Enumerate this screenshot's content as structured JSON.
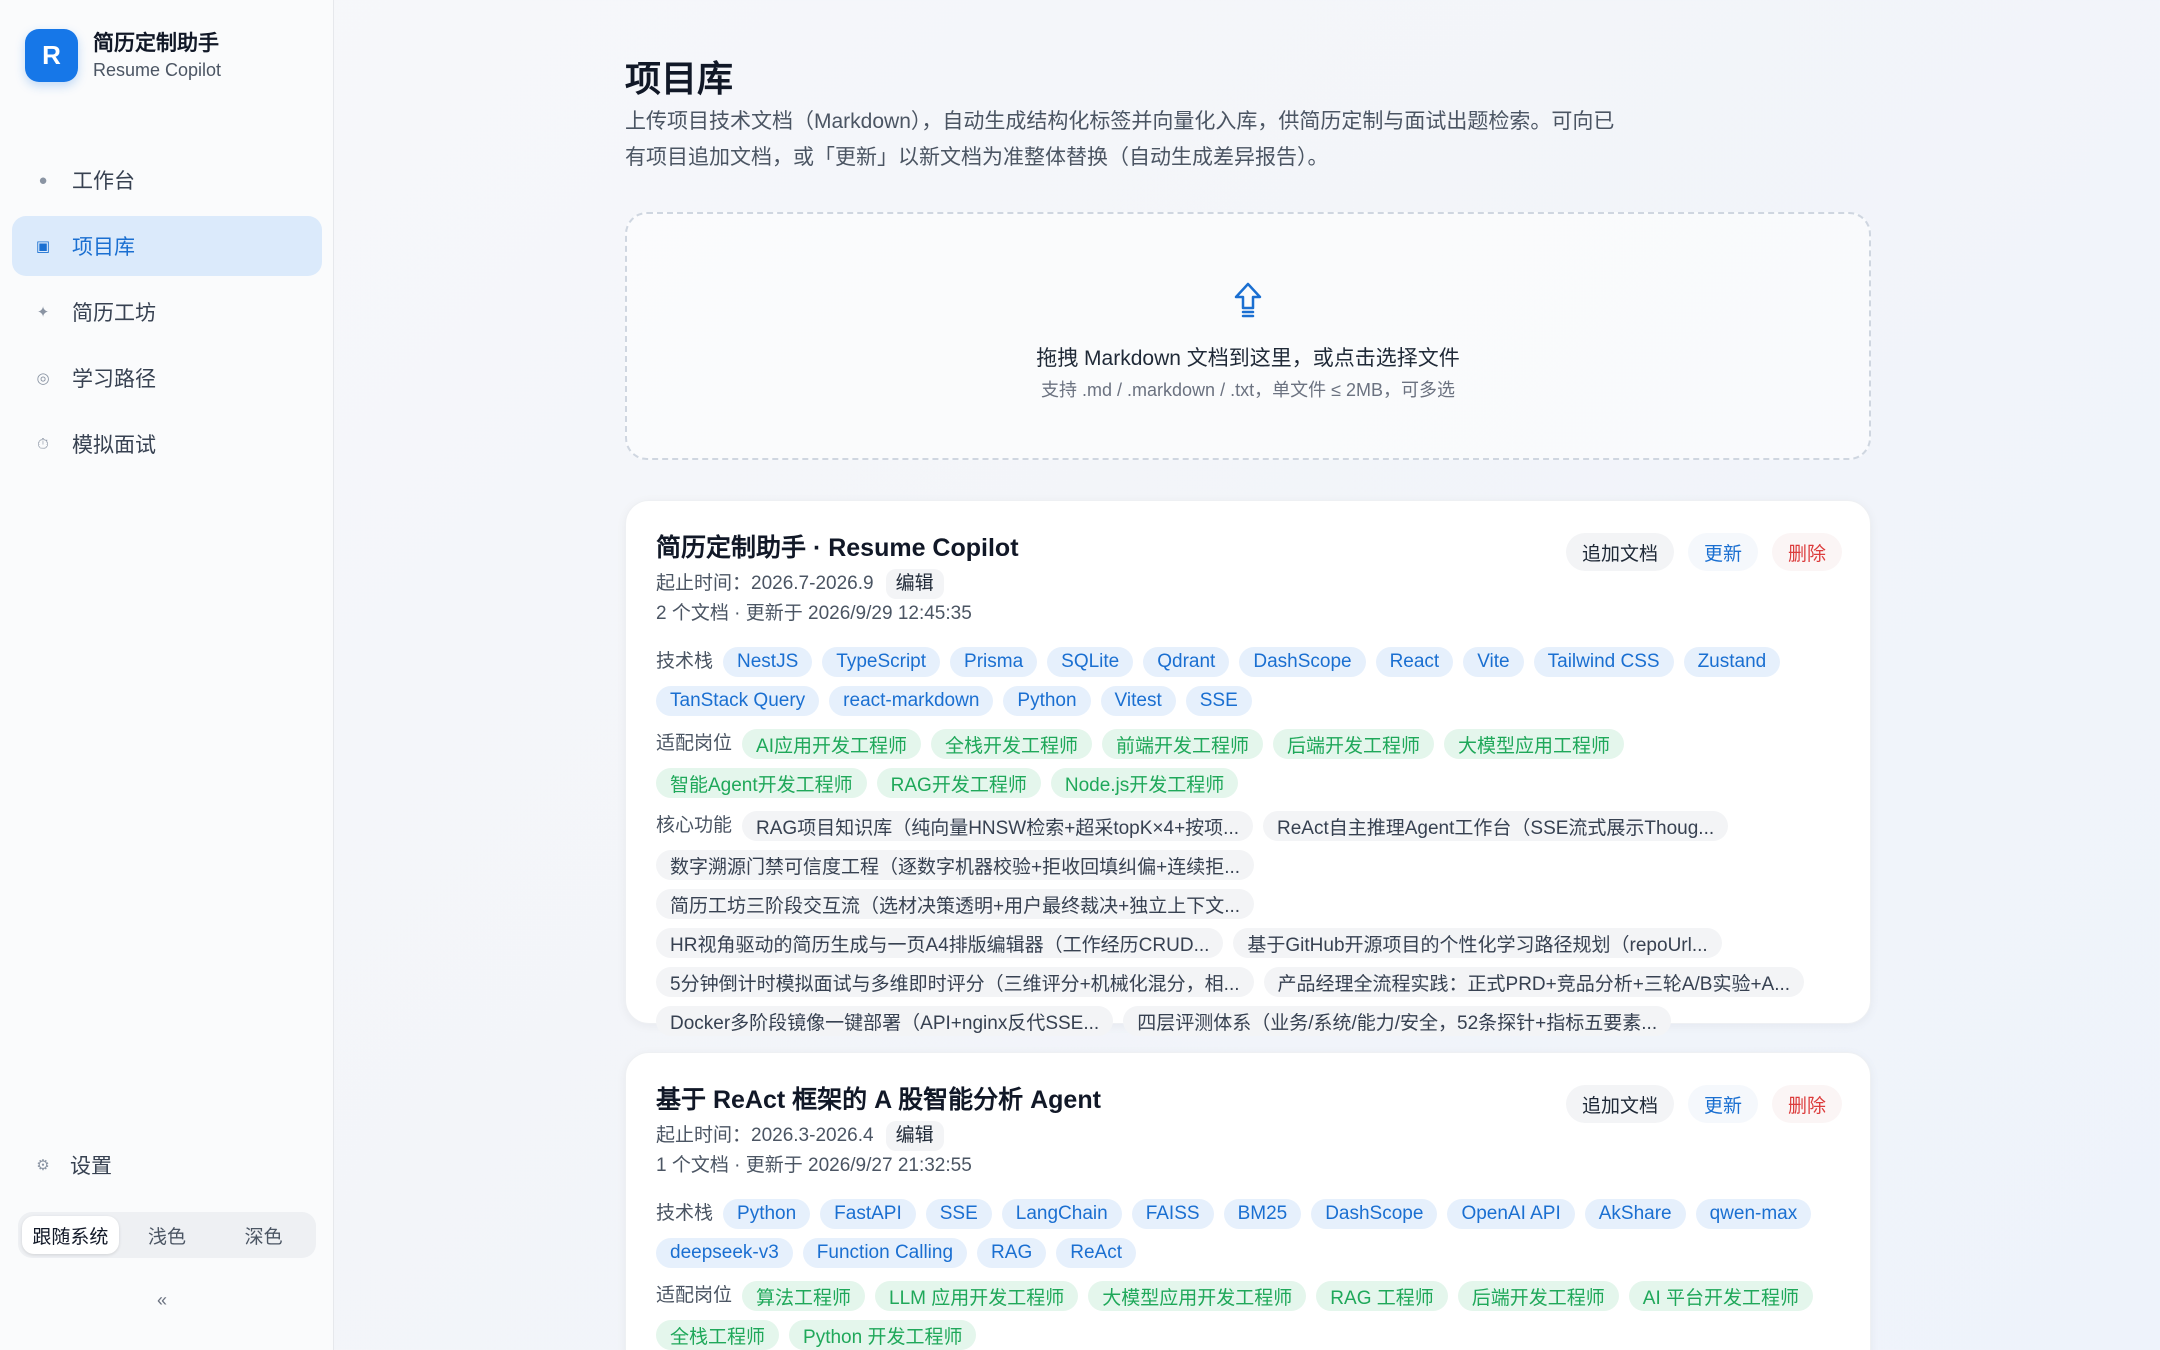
{
  "brand": {
    "logo_letter": "R",
    "title": "简历定制助手",
    "subtitle": "Resume Copilot"
  },
  "nav": [
    {
      "label": "工作台",
      "icon": "dot-icon"
    },
    {
      "label": "项目库",
      "icon": "square-icon",
      "active": true
    },
    {
      "label": "简历工坊",
      "icon": "sparkle-icon"
    },
    {
      "label": "学习路径",
      "icon": "target-icon"
    },
    {
      "label": "模拟面试",
      "icon": "timer-icon"
    }
  ],
  "settings_label": "设置",
  "theme": {
    "options": [
      "跟随系统",
      "浅色",
      "深色"
    ],
    "selected": "跟随系统"
  },
  "collapse_label": "«",
  "page": {
    "title": "项目库",
    "description": "上传项目技术文档（Markdown），自动生成结构化标签并向量化入库，供简历定制与面试出题检索。可向已有项目追加文档，或「更新」以新文档为准整体替换（自动生成差异报告）。"
  },
  "dropzone": {
    "main": "拖拽 Markdown 文档到这里，或点击选择文件",
    "sub": "支持 .md / .markdown / .txt，单文件 ≤ 2MB，可多选"
  },
  "labels": {
    "tech": "技术栈",
    "roles": "适配岗位",
    "features": "核心功能",
    "period_prefix": "起止时间：",
    "edit": "编辑",
    "add_doc": "追加文档",
    "update": "更新",
    "delete": "删除"
  },
  "projects": [
    {
      "title": "简历定制助手 · Resume Copilot",
      "period": "2026.7-2026.9",
      "doc_info": "2 个文档 · 更新于 2026/9/29 12:45:35",
      "tech": [
        "NestJS",
        "TypeScript",
        "Prisma",
        "SQLite",
        "Qdrant",
        "DashScope",
        "React",
        "Vite",
        "Tailwind CSS",
        "Zustand",
        "TanStack Query",
        "react-markdown",
        "Python",
        "Vitest",
        "SSE"
      ],
      "roles": [
        "AI应用开发工程师",
        "全栈开发工程师",
        "前端开发工程师",
        "后端开发工程师",
        "大模型应用工程师",
        "智能Agent开发工程师",
        "RAG开发工程师",
        "Node.js开发工程师"
      ],
      "features": [
        "RAG项目知识库（纯向量HNSW检索+超采topK×4+按项...",
        "ReAct自主推理Agent工作台（SSE流式展示Thoug...",
        "数字溯源门禁可信度工程（逐数字机器校验+拒收回填纠偏+连续拒...",
        "简历工坊三阶段交互流（选材决策透明+用户最终裁决+独立上下文...",
        "HR视角驱动的简历生成与一页A4排版编辑器（工作经历CRUD...",
        "基于GitHub开源项目的个性化学习路径规划（repoUrl...",
        "5分钟倒计时模拟面试与多维即时评分（三维评分+机械化混分，相...",
        "产品经理全流程实践：正式PRD+竞品分析+三轮A/B实验+A...",
        "Docker多阶段镜像一键部署（API+nginx反代SSE...",
        "四层评测体系（业务/系统/能力/安全，52条探针+指标五要素..."
      ]
    },
    {
      "title": "基于 ReAct 框架的 A 股智能分析 Agent",
      "period": "2026.3-2026.4",
      "doc_info": "1 个文档 · 更新于 2026/9/27 21:32:55",
      "tech": [
        "Python",
        "FastAPI",
        "SSE",
        "LangChain",
        "FAISS",
        "BM25",
        "DashScope",
        "OpenAI API",
        "AkShare",
        "qwen-max",
        "deepseek-v3",
        "Function Calling",
        "RAG",
        "ReAct"
      ],
      "roles": [
        "算法工程师",
        "LLM 应用开发工程师",
        "大模型应用开发工程师",
        "RAG 工程师",
        "后端开发工程师",
        "AI 平台开发工程师",
        "全栈工程师",
        "Python 开发工程师"
      ],
      "features": []
    }
  ]
}
